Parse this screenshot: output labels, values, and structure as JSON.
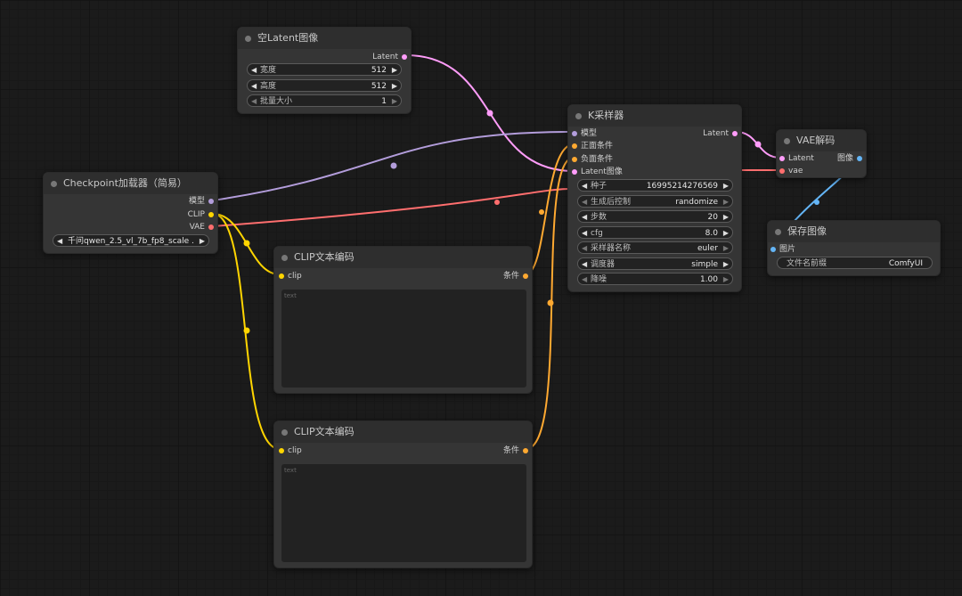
{
  "colors": {
    "latent": "#ff9cf9",
    "model": "#b39ddb",
    "clip": "#ffd500",
    "conditioning": "#ffa931",
    "vae": "#ff6e6e",
    "image": "#64b5f6"
  },
  "empty_latent": {
    "title": "空Latent图像",
    "output_latent": "Latent",
    "width": {
      "label": "宽度",
      "value": "512"
    },
    "height": {
      "label": "高度",
      "value": "512"
    },
    "batch": {
      "label": "批量大小",
      "value": "1"
    }
  },
  "checkpoint": {
    "title": "Checkpoint加载器（简易）",
    "output_model": "模型",
    "output_clip": "CLIP",
    "output_vae": "VAE",
    "ckpt_name": "千问qwen_2.5_vl_7b_fp8_scale ..."
  },
  "clip_top": {
    "title": "CLIP文本编码",
    "input_clip": "clip",
    "output_cond": "条件",
    "placeholder": "text"
  },
  "clip_bottom": {
    "title": "CLIP文本编码",
    "input_clip": "clip",
    "output_cond": "条件",
    "placeholder": "text"
  },
  "ksampler": {
    "title": "K采样器",
    "input_model": "模型",
    "input_positive": "正面条件",
    "input_negative": "负面条件",
    "input_latent": "Latent图像",
    "output_latent": "Latent",
    "seed": {
      "label": "种子",
      "value": "16995214276569"
    },
    "control": {
      "label": "生成后控制",
      "value": "randomize"
    },
    "steps": {
      "label": "步数",
      "value": "20"
    },
    "cfg": {
      "label": "cfg",
      "value": "8.0"
    },
    "sampler": {
      "label": "采样器名称",
      "value": "euler"
    },
    "scheduler": {
      "label": "调度器",
      "value": "simple"
    },
    "denoise": {
      "label": "降噪",
      "value": "1.00"
    }
  },
  "vae_decode": {
    "title": "VAE解码",
    "input_latent": "Latent",
    "input_vae": "vae",
    "output_image": "图像"
  },
  "save_image": {
    "title": "保存图像",
    "input_images": "图片",
    "prefix": {
      "label": "文件名前缀",
      "value": "ComfyUI"
    }
  }
}
